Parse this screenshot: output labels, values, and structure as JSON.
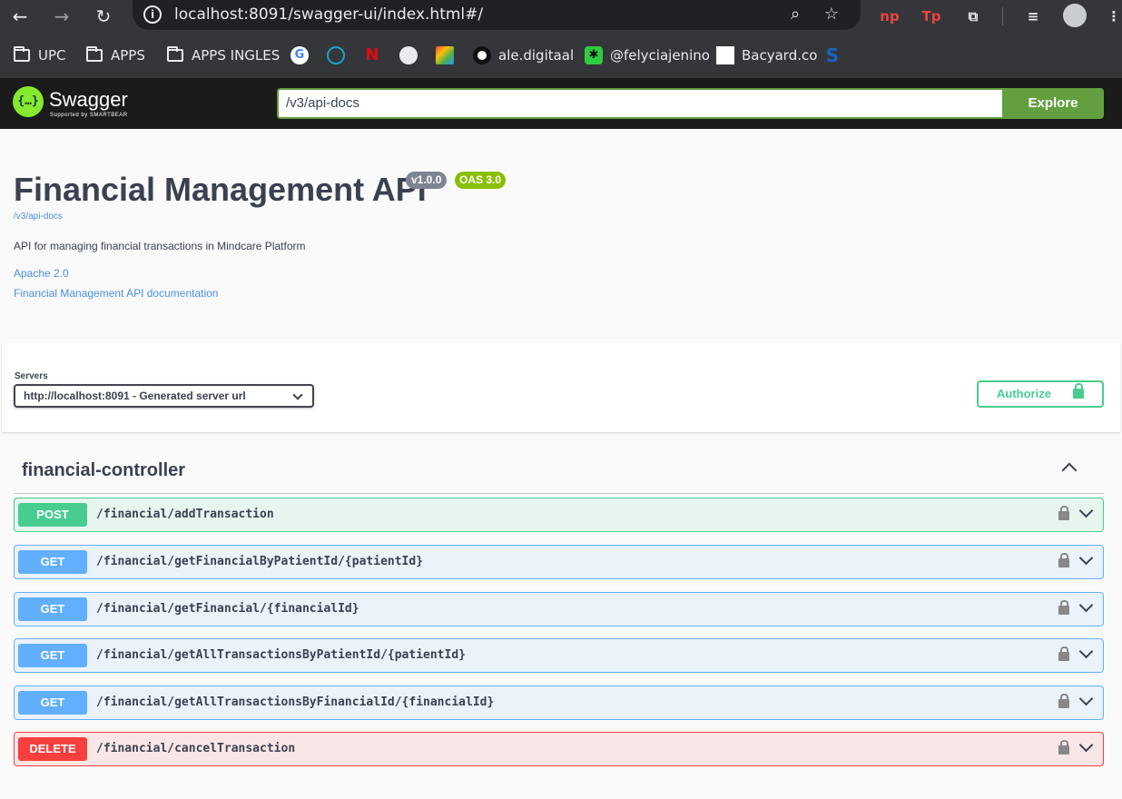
{
  "browser": {
    "url": "localhost:8091/swagger-ui/index.html#/",
    "back_icon": "back-arrow-icon",
    "forward_icon": "forward-arrow-icon",
    "reload_icon": "reload-icon",
    "extensions": [
      "np",
      "Tp"
    ]
  },
  "bookmarks": [
    {
      "label": "UPC",
      "type": "folder"
    },
    {
      "label": "APPS",
      "type": "folder"
    },
    {
      "label": "APPS INGLES",
      "type": "folder"
    },
    {
      "label": "G",
      "type": "icon"
    },
    {
      "label": "",
      "type": "icon"
    },
    {
      "label": "N",
      "type": "icon"
    },
    {
      "label": "",
      "type": "icon"
    },
    {
      "label": "",
      "type": "icon"
    },
    {
      "label": "ale.digitaal",
      "type": "site"
    },
    {
      "label": "@felyciajenino",
      "type": "site"
    },
    {
      "label": "Bacyard.co",
      "type": "site"
    },
    {
      "label": "S",
      "type": "icon"
    }
  ],
  "swagger": {
    "logo_text": "Swagger",
    "logo_sub": "Supported by SMARTBEAR",
    "logo_glyph": "{…}",
    "search_value": "/v3/api-docs",
    "explore_label": "Explore"
  },
  "info": {
    "title": "Financial Management API",
    "version": "v1.0.0",
    "oas": "OAS 3.0",
    "spec_url": "/v3/api-docs",
    "description": "API for managing financial transactions in Mindcare Platform",
    "license": "Apache 2.0",
    "external_docs": "Financial Management API documentation"
  },
  "servers": {
    "label": "Servers",
    "selected": "http://localhost:8091 - Generated server url",
    "authorize_label": "Authorize"
  },
  "tag": {
    "name": "financial-controller",
    "operations": [
      {
        "method": "POST",
        "path": "/financial/addTransaction"
      },
      {
        "method": "GET",
        "path": "/financial/getFinancialByPatientId/{patientId}"
      },
      {
        "method": "GET",
        "path": "/financial/getFinancial/{financialId}"
      },
      {
        "method": "GET",
        "path": "/financial/getAllTransactionsByPatientId/{patientId}"
      },
      {
        "method": "GET",
        "path": "/financial/getAllTransactionsByFinancialId/{financialId}"
      },
      {
        "method": "DELETE",
        "path": "/financial/cancelTransaction"
      }
    ]
  },
  "colors": {
    "post": "#49cc90",
    "get": "#61affe",
    "delete": "#f93e3e",
    "swagger_green": "#62a03f",
    "link": "#4990e2"
  }
}
